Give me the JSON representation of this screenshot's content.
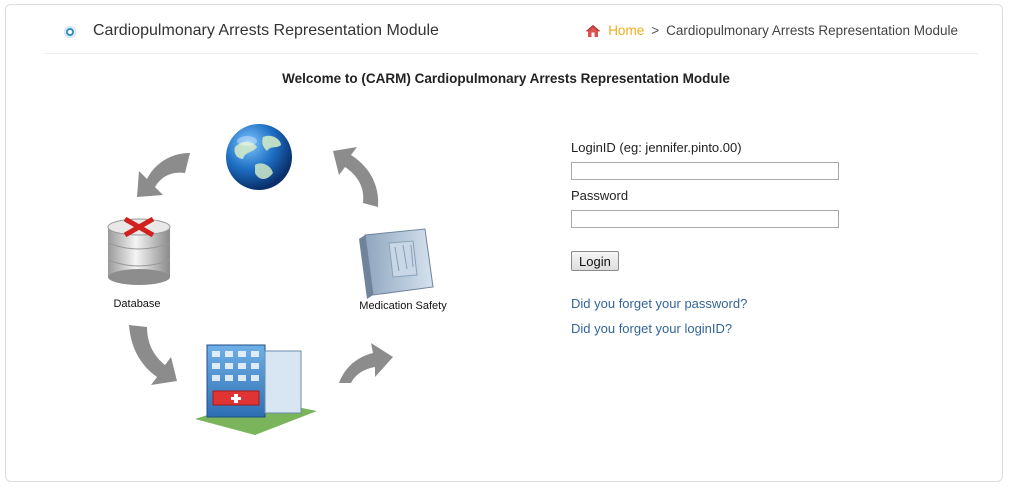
{
  "header": {
    "title": "Cardiopulmonary Arrests Representation Module",
    "breadcrumb": {
      "home": "Home",
      "separator": ">",
      "current": "Cardiopulmonary Arrests Representation Module"
    }
  },
  "welcome": "Welcome to (CARM) Cardiopulmonary Arrests Representation Module",
  "diagram": {
    "database_label": "Database",
    "medication_label": "Medication Safety",
    "icons": [
      "globe-icon",
      "database-icon",
      "hospital-icon",
      "medication-book-icon",
      "arrow-icon"
    ]
  },
  "login": {
    "loginid_label": "LoginID (eg: jennifer.pinto.00)",
    "loginid_value": "",
    "password_label": "Password",
    "password_value": "",
    "login_button": "Login",
    "forgot_password": "Did you forget your password?",
    "forgot_loginid": "Did you forget your loginID?"
  },
  "colors": {
    "accent_home": "#f0ad1e",
    "link": "#336699",
    "dot": "#3c8dbc"
  }
}
